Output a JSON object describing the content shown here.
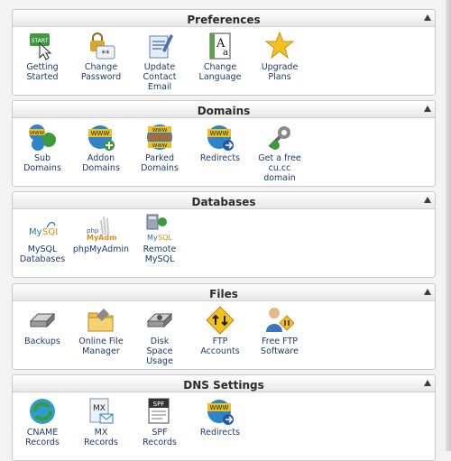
{
  "sections": [
    {
      "title": "Preferences",
      "items": [
        {
          "label": "Getting\nStarted",
          "icon": "start-icon"
        },
        {
          "label": "Change\nPassword",
          "icon": "password-lock-icon"
        },
        {
          "label": "Update\nContact\nEmail",
          "icon": "contact-email-icon"
        },
        {
          "label": "Change\nLanguage",
          "icon": "language-icon"
        },
        {
          "label": "Upgrade\nPlans",
          "icon": "star-icon"
        }
      ]
    },
    {
      "title": "Domains",
      "items": [
        {
          "label": "Sub\nDomains",
          "icon": "subdomains-icon"
        },
        {
          "label": "Addon\nDomains",
          "icon": "addon-domain-icon"
        },
        {
          "label": "Parked\nDomains",
          "icon": "parked-domain-icon"
        },
        {
          "label": "Redirects",
          "icon": "redirect-icon"
        },
        {
          "label": "Get a free\ncu.cc\ndomain",
          "icon": "free-domain-icon"
        }
      ]
    },
    {
      "title": "Databases",
      "items": [
        {
          "label": "MySQL\nDatabases",
          "icon": "mysql-icon"
        },
        {
          "label": "phpMyAdmin",
          "icon": "phpmyadmin-icon"
        },
        {
          "label": "Remote\nMySQL",
          "icon": "remote-mysql-icon"
        }
      ]
    },
    {
      "title": "Files",
      "items": [
        {
          "label": "Backups",
          "icon": "backup-drive-icon"
        },
        {
          "label": "Online File\nManager",
          "icon": "file-manager-icon"
        },
        {
          "label": "Disk\nSpace\nUsage",
          "icon": "disk-usage-icon"
        },
        {
          "label": "FTP\nAccounts",
          "icon": "ftp-accounts-icon"
        },
        {
          "label": "Free FTP\nSoftware",
          "icon": "ftp-software-icon"
        }
      ]
    },
    {
      "title": "DNS Settings",
      "items": [
        {
          "label": "CNAME\nRecords",
          "icon": "cname-icon"
        },
        {
          "label": "MX\nRecords",
          "icon": "mx-records-icon"
        },
        {
          "label": "SPF\nRecords",
          "icon": "spf-records-icon"
        },
        {
          "label": "Redirects",
          "icon": "redirect-icon"
        }
      ]
    }
  ]
}
